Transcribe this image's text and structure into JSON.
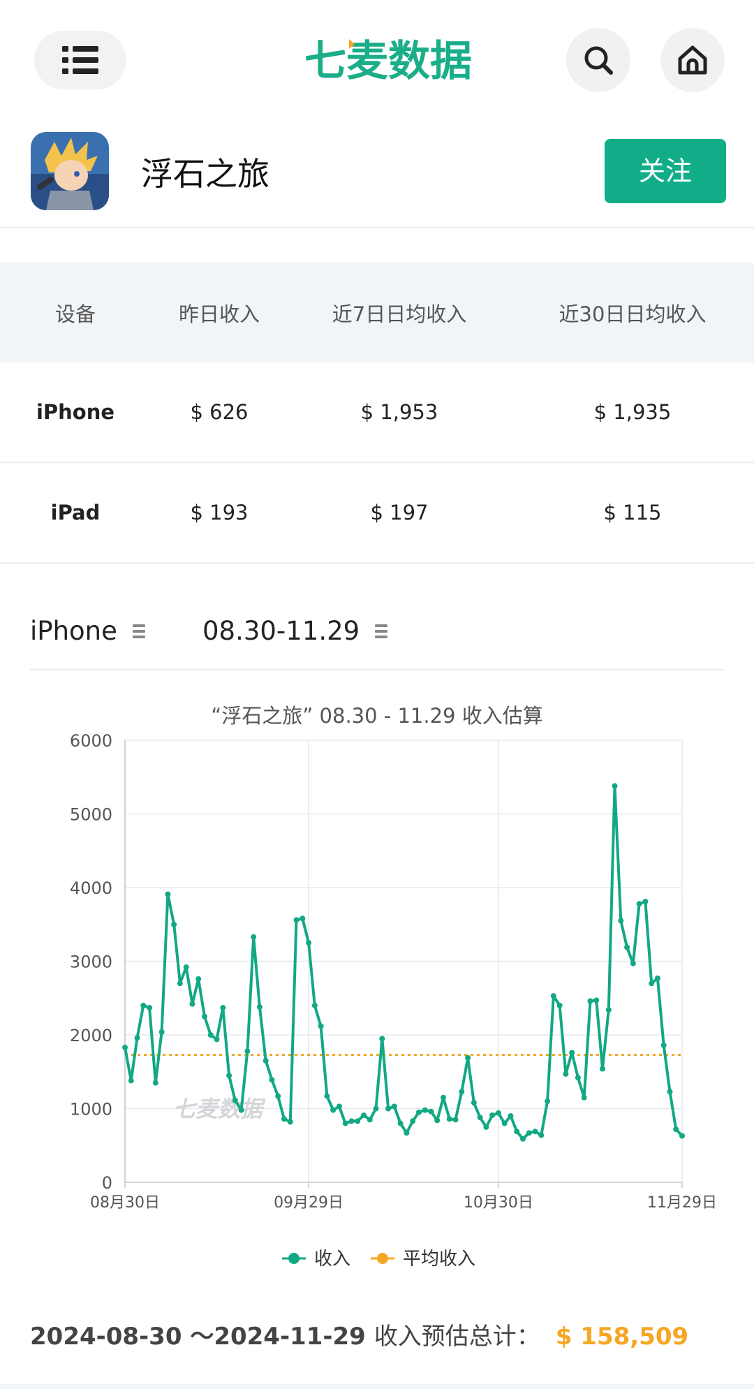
{
  "header": {
    "brand_text": "七麦数据",
    "icons": [
      "menu-icon",
      "search-icon",
      "home-icon"
    ],
    "brand_color": "#1aae88"
  },
  "app": {
    "name": "浮石之旅",
    "follow_label": "关注",
    "follow_color": "#10ad88"
  },
  "table": {
    "headers": [
      "设备",
      "昨日收入",
      "近7日日均收入",
      "近30日日均收入"
    ],
    "rows": [
      [
        "iPhone",
        "$ 626",
        "$ 1,953",
        "$ 1,935"
      ],
      [
        "iPad",
        "$ 193",
        "$ 197",
        "$ 115"
      ]
    ]
  },
  "filters": {
    "device": "iPhone",
    "date_range": "08.30-11.29"
  },
  "chart_data": {
    "type": "line",
    "title": "“浮石之旅” 08.30 - 11.29 收入估算",
    "watermark": "七麦数据",
    "ylim": [
      0,
      6000
    ],
    "yticks": [
      "6000",
      "5000",
      "4000",
      "3000",
      "2000",
      "1000",
      "0"
    ],
    "xticks": [
      "08月30日",
      "09月29日",
      "10月30日",
      "11月29日"
    ],
    "grid": true,
    "legend_position": "bottom",
    "series": [
      {
        "name": "收入",
        "color": "#12a884",
        "values": [
          1830,
          1380,
          1960,
          2400,
          2370,
          1350,
          2040,
          3910,
          3500,
          2700,
          2920,
          2420,
          2760,
          2250,
          2000,
          1940,
          2370,
          1450,
          1110,
          980,
          1780,
          3330,
          2380,
          1650,
          1390,
          1170,
          860,
          820,
          3560,
          3580,
          3250,
          2400,
          2120,
          1170,
          980,
          1030,
          800,
          830,
          830,
          910,
          850,
          1000,
          1950,
          1000,
          1030,
          800,
          670,
          830,
          950,
          980,
          960,
          840,
          1150,
          860,
          850,
          1230,
          1690,
          1080,
          880,
          750,
          910,
          940,
          800,
          900,
          690,
          590,
          670,
          690,
          640,
          1100,
          2530,
          2400,
          1470,
          1760,
          1420,
          1150,
          2460,
          2470,
          1540,
          2340,
          5380,
          3550,
          3190,
          2970,
          3780,
          3810,
          2700,
          2770,
          1860,
          1230,
          720,
          630
        ]
      },
      {
        "name": "平均收入",
        "color": "#f5a623",
        "value": 1730
      }
    ]
  },
  "total": {
    "range": "2024-08-30 ～2024-11-29",
    "label": "收入预估总计：",
    "amount": "$ 158,509",
    "amount_color": "#f5a623"
  }
}
